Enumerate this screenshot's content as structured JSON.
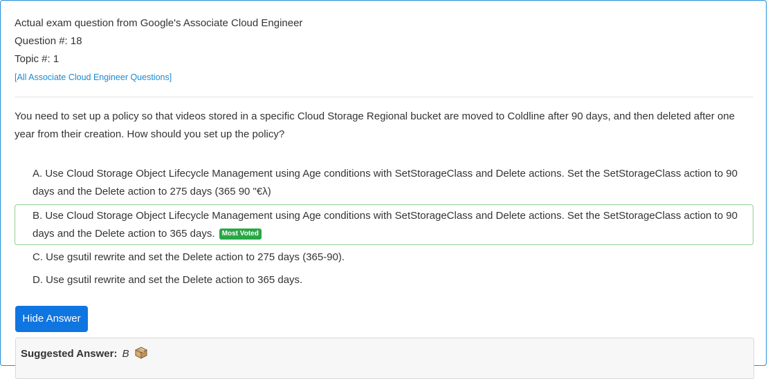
{
  "header": {
    "source_line": "Actual exam question from Google's Associate Cloud Engineer",
    "question_number": "Question #: 18",
    "topic_number": "Topic #: 1",
    "all_questions_link": "[All Associate Cloud Engineer Questions]"
  },
  "question": {
    "text": "You need to set up a policy so that videos stored in a specific Cloud Storage Regional bucket are moved to Coldline after 90 days, and then deleted after one year from their creation. How should you set up the policy?"
  },
  "choices": [
    {
      "text": "A. Use Cloud Storage Object Lifecycle Management using Age conditions with SetStorageClass and Delete actions. Set the SetStorageClass action to 90 days and the Delete action to 275 days (365 90 \"€λ)"
    },
    {
      "text": "B. Use Cloud Storage Object Lifecycle Management using Age conditions with SetStorageClass and Delete actions. Set the SetStorageClass action to 90 days and the Delete action to 365 days.",
      "badge": "Most Voted"
    },
    {
      "text": "C. Use gsutil rewrite and set the Delete action to 275 days (365-90)."
    },
    {
      "text": "D. Use gsutil rewrite and set the Delete action to 365 days."
    }
  ],
  "hide_answer_button": "Hide Answer",
  "suggested_answer": {
    "label": "Suggested Answer:",
    "value": "B",
    "icon": "package-icon"
  },
  "colors": {
    "link": "#1a8ad2",
    "button": "#0f75e0",
    "most_voted_badge": "#28a745",
    "voted_border": "#8fd08f",
    "card_border": "#1f8fd6"
  }
}
